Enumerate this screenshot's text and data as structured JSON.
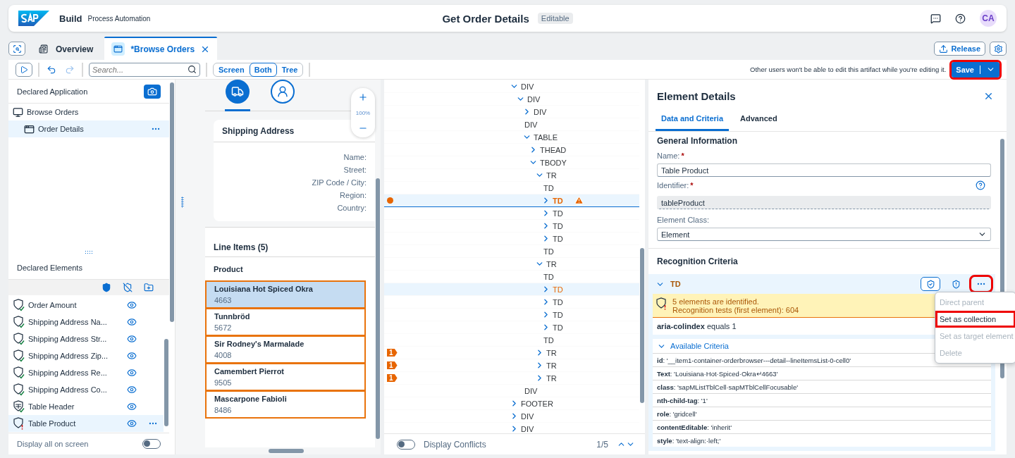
{
  "header": {
    "product": "Build",
    "subtitle": "Process Automation",
    "title": "Get Order Details",
    "badge": "Editable",
    "avatar": "CA"
  },
  "tabs": [
    {
      "label": "Overview",
      "selected": false,
      "kind": "overview"
    },
    {
      "label": "*Browse Orders",
      "selected": true,
      "kind": "editor"
    }
  ],
  "release": "Release",
  "toolbar": {
    "search": {
      "placeholder": "Search..."
    },
    "views": [
      {
        "label": "Screen",
        "selected": false
      },
      {
        "label": "Both",
        "selected": true
      },
      {
        "label": "Tree",
        "selected": false
      }
    ],
    "message": "Other users won't be able to edit this artifact while you're editing it.",
    "save": {
      "label": "Save",
      "outlined": true
    }
  },
  "application": {
    "title": "Declared Application",
    "tree": [
      {
        "label": "Browse Orders",
        "selected": false,
        "children": [
          {
            "label": "Order Details",
            "selected": true
          }
        ]
      }
    ]
  },
  "elements": {
    "title": "Declared Elements",
    "items": [
      {
        "label": "Order Amount",
        "kind": "element",
        "error": false,
        "selected": false
      },
      {
        "label": "Shipping Address Na...",
        "kind": "element",
        "error": false,
        "selected": false
      },
      {
        "label": "Shipping Address Str...",
        "kind": "element",
        "error": false,
        "selected": false
      },
      {
        "label": "Shipping Address Zip...",
        "kind": "element",
        "error": false,
        "selected": false
      },
      {
        "label": "Shipping Address Re...",
        "kind": "element",
        "error": false,
        "selected": false
      },
      {
        "label": "Shipping Address Co...",
        "kind": "element",
        "error": false,
        "selected": false
      },
      {
        "label": "Table Header",
        "kind": "header",
        "error": false,
        "selected": false
      },
      {
        "label": "Table Product",
        "kind": "element",
        "error": true,
        "selected": true
      }
    ],
    "display_all": {
      "label": "Display all on screen",
      "on": false
    }
  },
  "preview": {
    "icon_tabs": [
      {
        "kind": "truck",
        "selected": true
      },
      {
        "kind": "person",
        "selected": false
      }
    ],
    "zoom": "100%",
    "shipping": {
      "title": "Shipping Address",
      "fields": [
        "Name:",
        "Street:",
        "ZIP Code / City:",
        "Region:",
        "Country:"
      ]
    },
    "line_items": {
      "title": "Line Items (5)",
      "column": "Product",
      "rows": [
        {
          "name": "Louisiana Hot Spiced Okra",
          "number": "4663",
          "selected": true,
          "outlined": true
        },
        {
          "name": "Tunnbröd",
          "number": "5672",
          "selected": false,
          "outlined": true
        },
        {
          "name": "Sir Rodney's Marmalade",
          "number": "4008",
          "selected": false,
          "outlined": true
        },
        {
          "name": "Camembert Pierrot",
          "number": "9505",
          "selected": false,
          "outlined": true
        },
        {
          "name": "Mascarpone Fabioli",
          "number": "8486",
          "selected": false,
          "outlined": true
        }
      ]
    }
  },
  "dom_tree": {
    "nodes": [
      {
        "label": "DIV",
        "kind": "node",
        "expanded": true,
        "selected": false,
        "highlighted": false,
        "children": [
          {
            "label": "DIV",
            "kind": "node",
            "expanded": true,
            "selected": false,
            "highlighted": false,
            "children": [
              {
                "label": "DIV",
                "kind": "node",
                "expanded": false,
                "selected": false,
                "highlighted": false
              },
              {
                "label": "DIV",
                "kind": "leaf",
                "selected": false,
                "highlighted": false
              },
              {
                "label": "TABLE",
                "kind": "node",
                "expanded": true,
                "selected": false,
                "highlighted": false,
                "children": [
                  {
                    "label": "THEAD",
                    "kind": "node",
                    "expanded": false,
                    "selected": false,
                    "highlighted": false
                  },
                  {
                    "label": "TBODY",
                    "kind": "node",
                    "expanded": true,
                    "selected": false,
                    "highlighted": false,
                    "children": [
                      {
                        "label": "TR",
                        "kind": "node",
                        "expanded": true,
                        "selected": false,
                        "highlighted": false,
                        "children": [
                          {
                            "label": "TD",
                            "kind": "leaf",
                            "selected": false,
                            "highlighted": false
                          },
                          {
                            "label": "TD",
                            "kind": "node",
                            "expanded": false,
                            "selected": true,
                            "highlighted": true
                          },
                          {
                            "label": "TD",
                            "kind": "node",
                            "expanded": false,
                            "selected": false,
                            "highlighted": false
                          },
                          {
                            "label": "TD",
                            "kind": "node",
                            "expanded": false,
                            "selected": false,
                            "highlighted": false
                          },
                          {
                            "label": "TD",
                            "kind": "node",
                            "expanded": false,
                            "selected": false,
                            "highlighted": false
                          },
                          {
                            "label": "TD",
                            "kind": "leaf",
                            "selected": false,
                            "highlighted": false
                          }
                        ]
                      },
                      {
                        "label": "TR",
                        "kind": "node",
                        "expanded": true,
                        "selected": false,
                        "highlighted": false,
                        "children": [
                          {
                            "label": "TD",
                            "kind": "leaf",
                            "selected": false,
                            "highlighted": false
                          },
                          {
                            "label": "TD",
                            "kind": "node",
                            "expanded": false,
                            "selected": false,
                            "highlighted": true
                          },
                          {
                            "label": "TD",
                            "kind": "node",
                            "expanded": false,
                            "selected": false,
                            "highlighted": false
                          },
                          {
                            "label": "TD",
                            "kind": "node",
                            "expanded": false,
                            "selected": false,
                            "highlighted": false
                          },
                          {
                            "label": "TD",
                            "kind": "node",
                            "expanded": false,
                            "selected": false,
                            "highlighted": false
                          },
                          {
                            "label": "TD",
                            "kind": "leaf",
                            "selected": false,
                            "highlighted": false
                          }
                        ]
                      },
                      {
                        "label": "TR",
                        "kind": "node",
                        "expanded": false,
                        "selected": false,
                        "highlighted": false,
                        "badge": "1"
                      },
                      {
                        "label": "TR",
                        "kind": "node",
                        "expanded": false,
                        "selected": false,
                        "highlighted": false,
                        "badge": "1"
                      },
                      {
                        "label": "TR",
                        "kind": "node",
                        "expanded": false,
                        "selected": false,
                        "highlighted": false,
                        "badge": "1"
                      }
                    ]
                  }
                ]
              },
              {
                "label": "DIV",
                "kind": "leaf",
                "selected": false,
                "highlighted": false
              }
            ]
          }
        ]
      },
      {
        "label": "FOOTER",
        "kind": "node",
        "expanded": false,
        "selected": false,
        "highlighted": false
      },
      {
        "label": "DIV",
        "kind": "node",
        "expanded": false,
        "selected": false,
        "highlighted": false
      },
      {
        "label": "DIV",
        "kind": "node",
        "expanded": false,
        "selected": false,
        "highlighted": false
      }
    ],
    "conflicts": {
      "label": "Display Conflicts",
      "on": false,
      "counter": "1/5"
    }
  },
  "details": {
    "title": "Element Details",
    "tabs": [
      {
        "label": "Data and Criteria",
        "selected": true
      },
      {
        "label": "Advanced",
        "selected": false
      }
    ],
    "general": {
      "title": "General Information",
      "name": {
        "label": "Name:",
        "required_mark": "*",
        "value": "Table Product"
      },
      "identifier": {
        "label": "Identifier:",
        "required_mark": "*",
        "value": "tableProduct",
        "disabled": true
      },
      "element_class": {
        "label": "Element Class:",
        "value": "Element"
      }
    },
    "recognition": {
      "title": "Recognition Criteria",
      "criterion": {
        "label": "TD",
        "expanded": true,
        "actions": [
          {
            "kind": "validate",
            "outlined": false
          },
          {
            "kind": "badge",
            "outlined": false
          },
          {
            "kind": "more",
            "outlined": true
          }
        ],
        "warning": [
          "5 elements are identified.",
          "Recognition tests (first element): 604"
        ],
        "rule": "**aria-colindex** equals 1",
        "available": {
          "label": "Available Criteria",
          "expanded": true,
          "items": [
            "**id**: '__item1-container-orderbrowser---detail--lineItemsList-0-cell0'",
            "**Text**: 'Louisiana·Hot·Spiced·Okra↵4663'",
            "**class**: 'sapMListTblCell·sapMTblCellFocusable'",
            "**nth-child-tag**: '1'",
            "**role**: 'gridcell'",
            "**contentEditable**: 'inherit'",
            "**style**: 'text-align:·left;'"
          ]
        }
      },
      "menu": [
        {
          "label": "Direct parent",
          "disabled": true,
          "outlined": false
        },
        {
          "label": "Set as collection",
          "disabled": false,
          "outlined": true
        },
        {
          "label": "Set as target element",
          "disabled": true,
          "outlined": false
        },
        {
          "label": "Delete",
          "disabled": true,
          "outlined": false
        }
      ]
    }
  }
}
